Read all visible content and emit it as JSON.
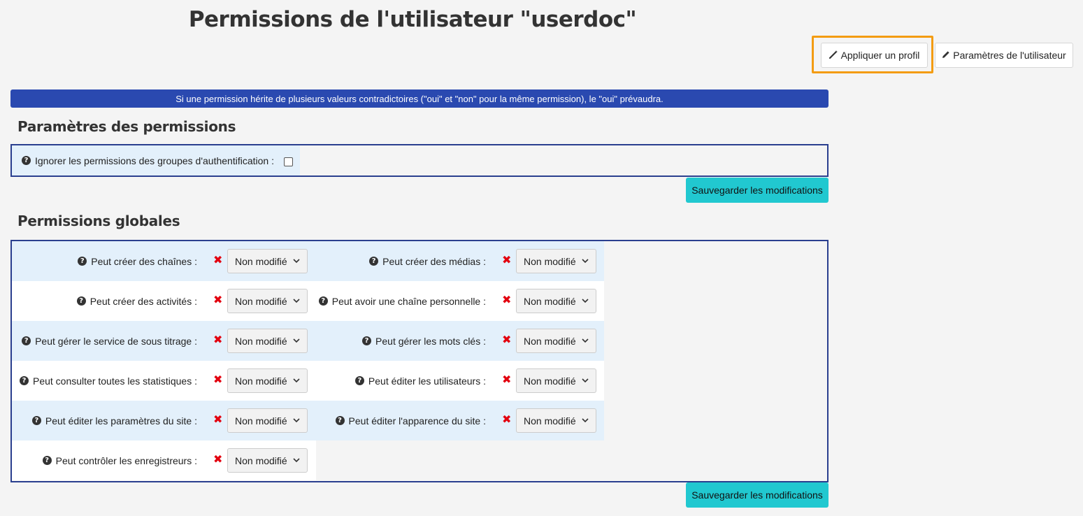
{
  "header": {
    "title": "Permissions de l'utilisateur \"userdoc\"",
    "apply_profile_label": "Appliquer un profil",
    "user_params_label": "Paramètres de l'utilisateur"
  },
  "banner": {
    "text": "Si une permission hérite de plusieurs valeurs contradictoires (\"oui\" et \"non\" pour la même permission), le \"oui\" prévaudra."
  },
  "settings_section": {
    "title": "Paramètres des permissions",
    "ignore_label": "Ignorer les permissions des groupes d'authentification :",
    "ignore_checked": false,
    "save_label": "Sauvegarder les modifications"
  },
  "global_section": {
    "title": "Permissions globales",
    "save_label": "Sauvegarder les modifications",
    "permissions": [
      {
        "label": "Peut créer des chaînes :",
        "value": "Non modifié"
      },
      {
        "label": "Peut créer des médias :",
        "value": "Non modifié"
      },
      {
        "label": "Peut créer des activités :",
        "value": "Non modifié"
      },
      {
        "label": "Peut avoir une chaîne personnelle :",
        "value": "Non modifié"
      },
      {
        "label": "Peut gérer le service de sous titrage :",
        "value": "Non modifié"
      },
      {
        "label": "Peut gérer les mots clés :",
        "value": "Non modifié"
      },
      {
        "label": "Peut consulter toutes les statistiques :",
        "value": "Non modifié"
      },
      {
        "label": "Peut éditer les utilisateurs :",
        "value": "Non modifié"
      },
      {
        "label": "Peut éditer les paramètres du site :",
        "value": "Non modifié"
      },
      {
        "label": "Peut éditer l'apparence du site :",
        "value": "Non modifié"
      },
      {
        "label": "Peut contrôler les enregistreurs :",
        "value": "Non modifié"
      }
    ]
  },
  "icons": {
    "help": "question-circle-icon",
    "deny": "x-mark-icon",
    "wand": "magic-wand-icon",
    "pencil": "pencil-icon"
  },
  "colors": {
    "banner": "#2a49b0",
    "save_button": "#21c8d0",
    "highlight": "#f39c12",
    "deny": "#e3000f"
  }
}
